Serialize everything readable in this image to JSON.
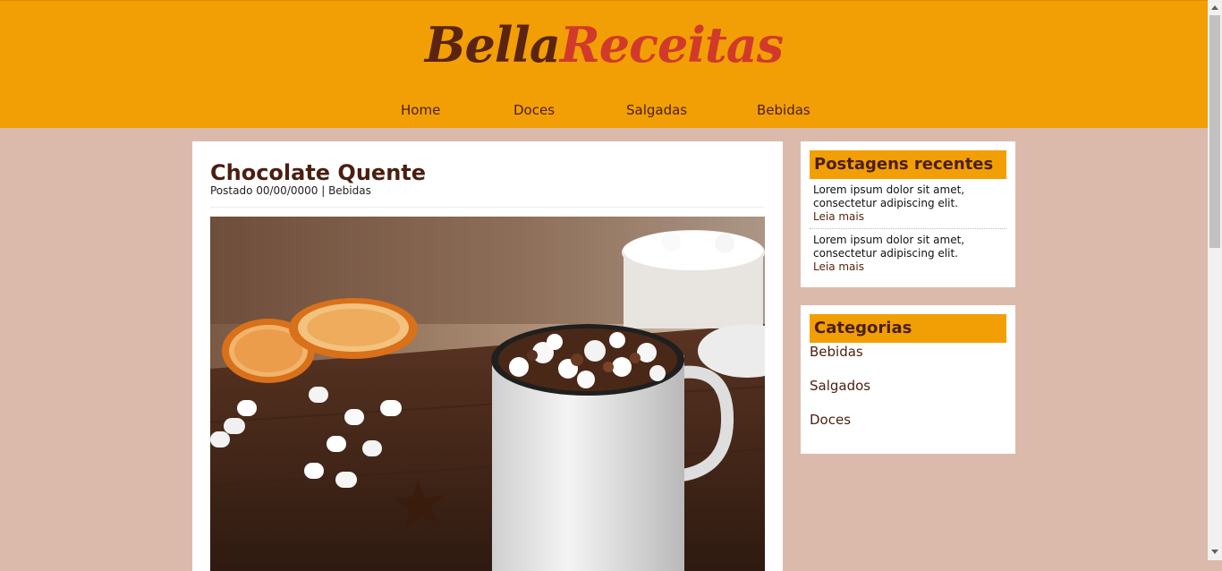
{
  "header": {
    "logo_part1": "Bella",
    "logo_part2": "Receitas",
    "nav": [
      "Home",
      "Doces",
      "Salgadas",
      "Bebidas"
    ]
  },
  "post": {
    "title": "Chocolate Quente",
    "meta": "Postado 00/00/0000 | Bebidas"
  },
  "sidebar": {
    "recent": {
      "title": "Postagens recentes",
      "items": [
        {
          "text": "Lorem ipsum dolor sit amet, consectetur adipiscing elit.",
          "more": "Leia mais"
        },
        {
          "text": "Lorem ipsum dolor sit amet, consectetur adipiscing elit.",
          "more": "Leia mais"
        }
      ]
    },
    "categories": {
      "title": "Categorias",
      "items": [
        "Bebidas",
        "Salgados",
        "Doces"
      ]
    }
  },
  "colors": {
    "header_bg": "#f29f05",
    "page_bg": "#dbbaab",
    "text_brown": "#4a1f10",
    "logo_red": "#d13a2a"
  }
}
